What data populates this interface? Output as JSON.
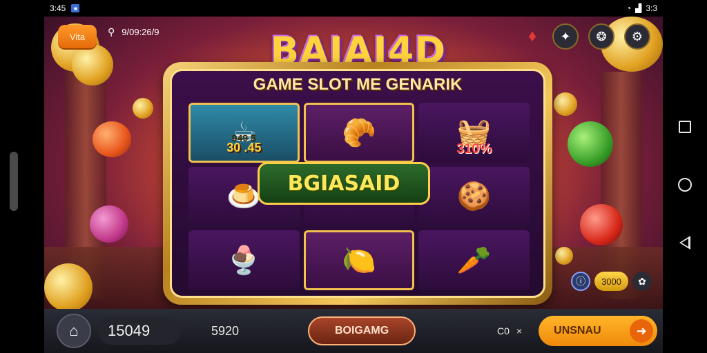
{
  "status_bar": {
    "time": "3:45",
    "right_text": "3:3"
  },
  "top": {
    "vip_label": "Vita",
    "search_text": "9/09:26/9",
    "title": "BAJAJ4D"
  },
  "frame": {
    "heading": "GAME SLOT ME GENARIK",
    "cell_texts": {
      "multiplier": "30 .45",
      "percent": "310%",
      "small": "949 $"
    },
    "banner": "BGIASAID"
  },
  "bet": {
    "value": "3000"
  },
  "bottom": {
    "balance": "15049",
    "win": "5920",
    "center_label": "BOIGAMG",
    "counter_left": "C0",
    "counter_x": "×",
    "spin_label": "UNSNAU"
  },
  "icons": {
    "wifi": "wifi-icon",
    "signal": "signal-icon",
    "battery": "battery-icon",
    "search": "search-icon",
    "gift": "gift-icon",
    "star": "star-icon",
    "globe": "globe-icon",
    "gear": "gear-icon",
    "home": "home-icon",
    "arrow": "arrow-right-icon"
  },
  "colors": {
    "accent": "#f08a0a",
    "gold": "#f2c14e",
    "purple": "#3c0f4a"
  }
}
